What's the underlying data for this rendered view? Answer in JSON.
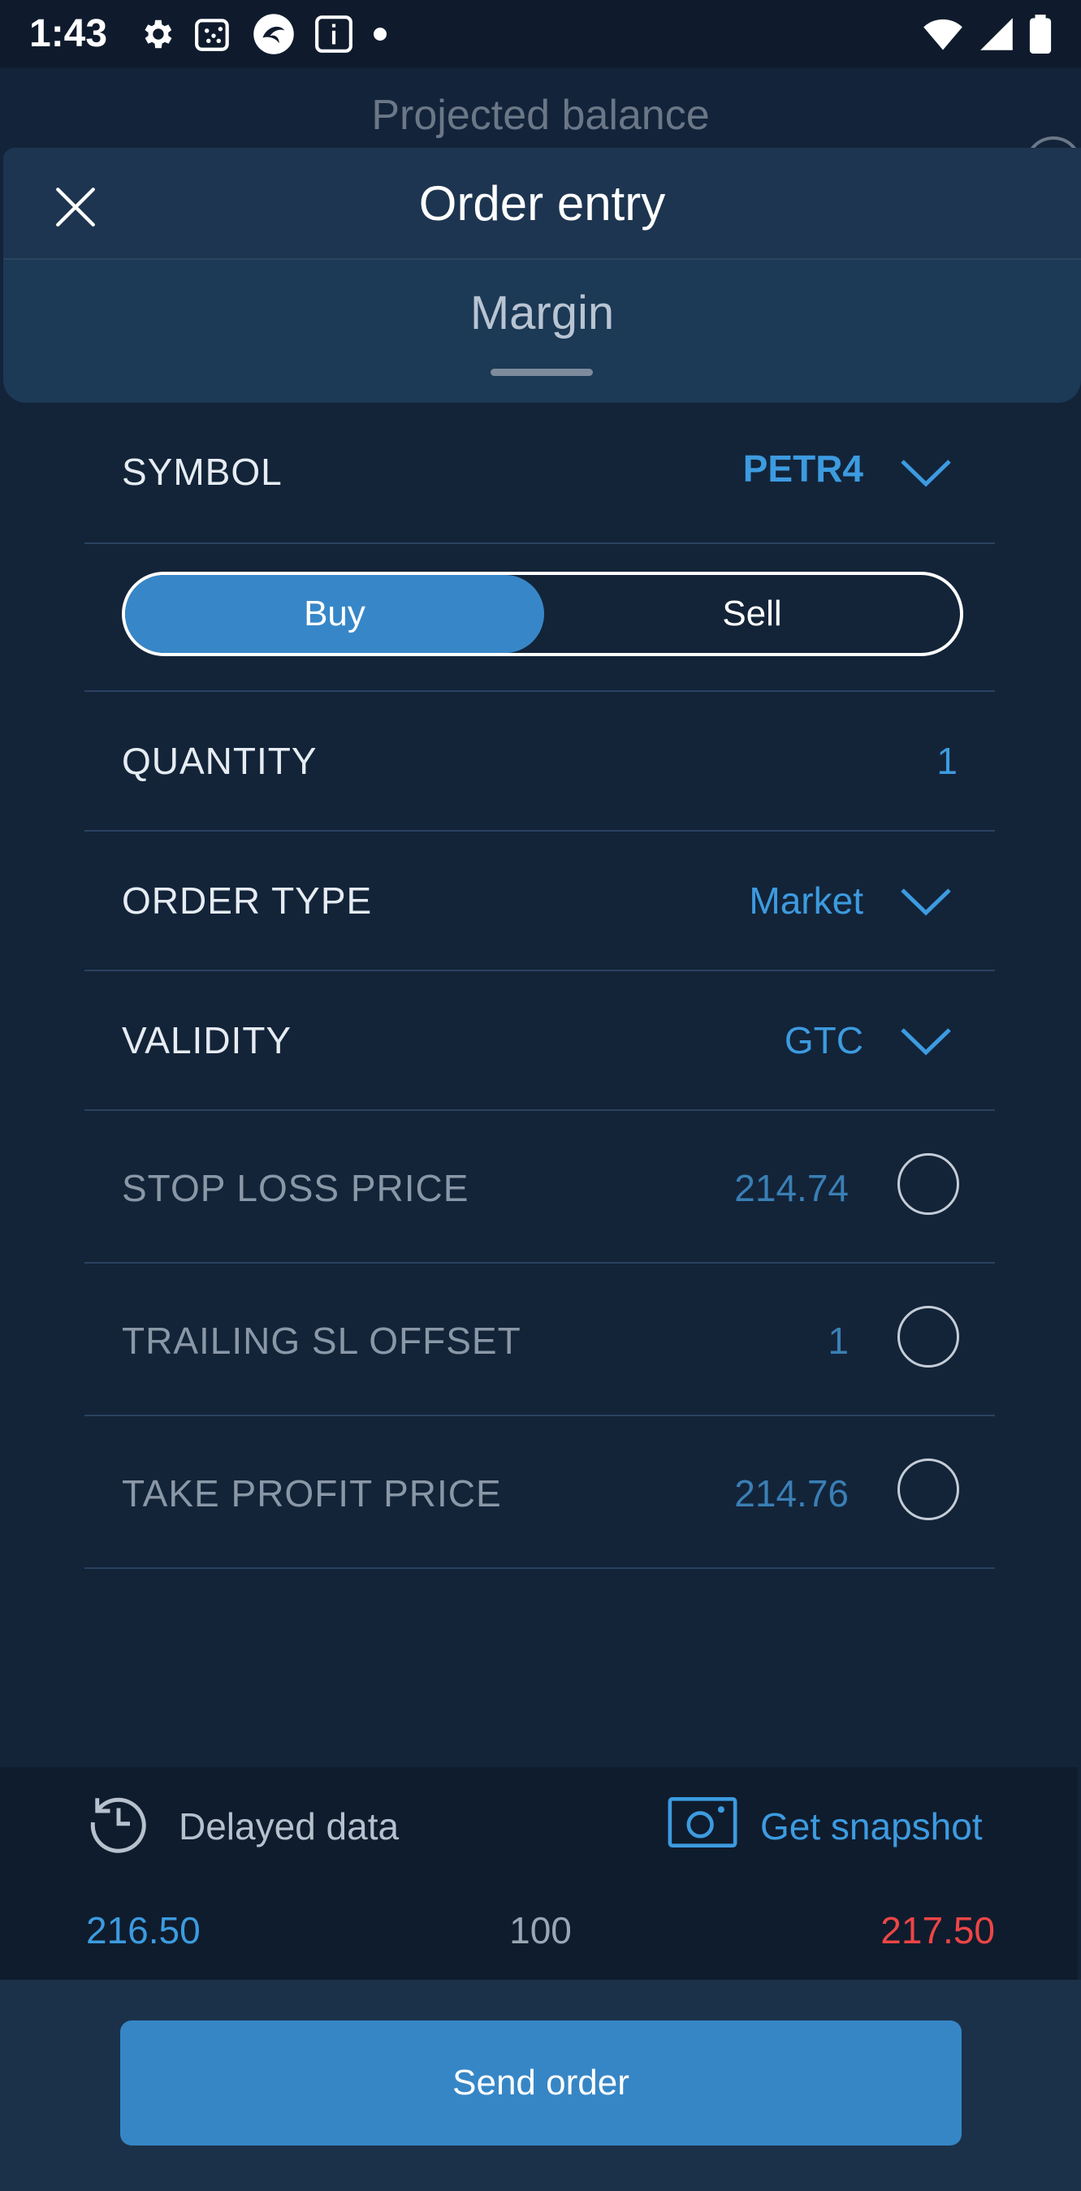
{
  "status_bar": {
    "time": "1:43"
  },
  "background_screen": {
    "title": "Projected balance"
  },
  "sheet": {
    "title": "Order entry",
    "tab": "Margin"
  },
  "form": {
    "symbol": {
      "label": "SYMBOL",
      "value": "PETR4"
    },
    "side": {
      "buy_label": "Buy",
      "sell_label": "Sell",
      "selected": "Buy"
    },
    "quantity": {
      "label": "QUANTITY",
      "value": "1"
    },
    "order_type": {
      "label": "ORDER TYPE",
      "value": "Market"
    },
    "validity": {
      "label": "VALIDITY",
      "value": "GTC"
    },
    "stop_loss": {
      "label": "STOP LOSS PRICE",
      "value": "214.74",
      "enabled": false
    },
    "trailing_sl": {
      "label": "TRAILING SL OFFSET",
      "value": "1",
      "enabled": false
    },
    "take_profit": {
      "label": "TAKE PROFIT PRICE",
      "value": "214.76",
      "enabled": false
    }
  },
  "market_info": {
    "delayed_label": "Delayed data",
    "snapshot_label": "Get snapshot",
    "bid": "216.50",
    "volume": "100",
    "ask": "217.50"
  },
  "actions": {
    "send_label": "Send order"
  },
  "colors": {
    "accent": "#3d9be0",
    "button": "#3686c6",
    "ask_red": "#ee4546",
    "background": "#132439"
  }
}
